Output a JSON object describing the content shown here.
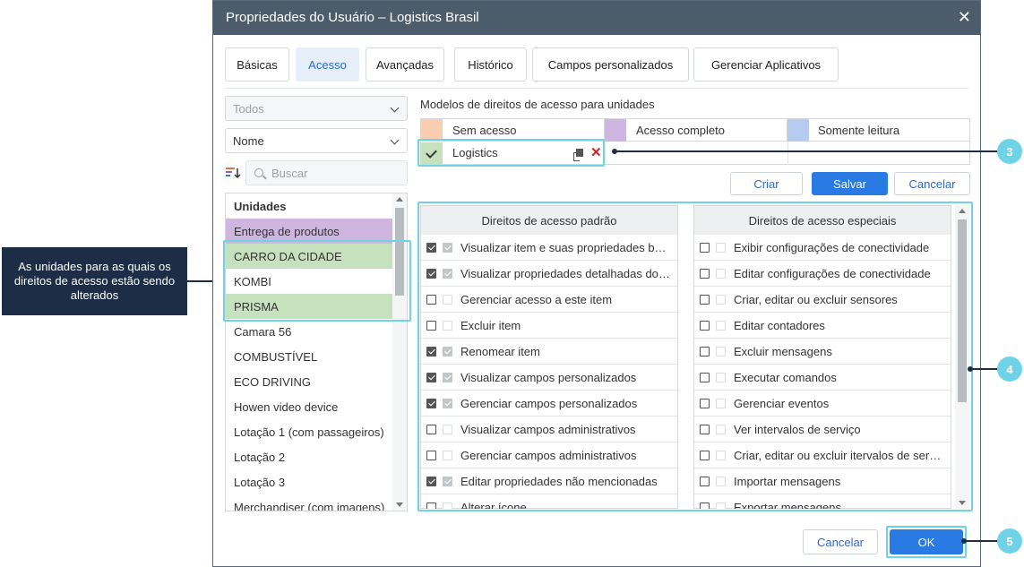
{
  "dialog": {
    "title": "Propriedades do Usuário – Logistics Brasil",
    "close_glyph": "✕"
  },
  "tabs": [
    {
      "label": "Básicas",
      "active": false
    },
    {
      "label": "Acesso",
      "active": true
    },
    {
      "label": "Avançadas",
      "active": false
    },
    {
      "label": "Histórico",
      "active": false
    },
    {
      "label": "Campos personalizados",
      "active": false
    },
    {
      "label": "Gerenciar Aplicativos",
      "active": false
    }
  ],
  "filters": {
    "type_select": "Todos",
    "sort_select": "Nome",
    "search_placeholder": "Buscar"
  },
  "units": {
    "header": "Unidades",
    "items": [
      {
        "label": "Entrega de produtos",
        "state": "purple"
      },
      {
        "label": "CARRO DA CIDADE",
        "state": "green"
      },
      {
        "label": "KOMBI",
        "state": "none"
      },
      {
        "label": "PRISMA",
        "state": "green"
      },
      {
        "label": "Camara 56",
        "state": "none"
      },
      {
        "label": "COMBUSTÍVEL",
        "state": "none"
      },
      {
        "label": "ECO DRIVING",
        "state": "none"
      },
      {
        "label": "Howen video device",
        "state": "none"
      },
      {
        "label": "Lotação 1 (com passageiros)",
        "state": "none"
      },
      {
        "label": "Lotação 2",
        "state": "none"
      },
      {
        "label": "Lotação 3",
        "state": "none"
      },
      {
        "label": "Merchandiser (com imagens)",
        "state": "none"
      }
    ]
  },
  "models": {
    "title": "Modelos de direitos de acesso para unidades",
    "legend": [
      {
        "label": "Sem acesso",
        "color": "#f8cdb0"
      },
      {
        "label": "Acesso completo",
        "color": "#cfb6e0"
      },
      {
        "label": "Somente leitura",
        "color": "#b5cbef"
      }
    ],
    "template": {
      "label": "Logistics",
      "color": "#c6e1bd"
    }
  },
  "actions": {
    "create": "Criar",
    "save": "Salvar",
    "cancel": "Cancelar"
  },
  "rights": {
    "standard_header": "Direitos de acesso padrão",
    "special_header": "Direitos de acesso especiais",
    "standard": [
      {
        "label": "Visualizar item e suas propriedades básicas",
        "checked": true
      },
      {
        "label": "Visualizar propriedades detalhadas do item",
        "checked": true
      },
      {
        "label": "Gerenciar acesso a este item",
        "checked": false
      },
      {
        "label": "Excluir item",
        "checked": false
      },
      {
        "label": "Renomear item",
        "checked": true
      },
      {
        "label": "Visualizar campos personalizados",
        "checked": true
      },
      {
        "label": "Gerenciar campos personalizados",
        "checked": true
      },
      {
        "label": "Visualizar campos administrativos",
        "checked": false
      },
      {
        "label": "Gerenciar campos administrativos",
        "checked": false
      },
      {
        "label": "Editar propriedades não mencionadas",
        "checked": true
      },
      {
        "label": "Alterar ícone",
        "checked": false
      }
    ],
    "special": [
      {
        "label": "Exibir configurações de conectividade",
        "checked": false
      },
      {
        "label": "Editar configurações de conectividade",
        "checked": false
      },
      {
        "label": "Criar, editar ou excluir sensores",
        "checked": false
      },
      {
        "label": "Editar contadores",
        "checked": false
      },
      {
        "label": "Excluir mensagens",
        "checked": false
      },
      {
        "label": "Executar comandos",
        "checked": false
      },
      {
        "label": "Gerenciar eventos",
        "checked": false
      },
      {
        "label": "Ver intervalos de serviço",
        "checked": false
      },
      {
        "label": "Criar, editar ou excluir itervalos de serviço",
        "checked": false
      },
      {
        "label": "Importar mensagens",
        "checked": false
      },
      {
        "label": "Exportar mensagens",
        "checked": false
      }
    ]
  },
  "footer": {
    "cancel": "Cancelar",
    "ok": "OK"
  },
  "annotations": {
    "note": "As unidades para as quais os direitos de acesso estão sendo alterados",
    "badges": [
      "3",
      "4",
      "5"
    ],
    "highlight_color": "#6fd3e8",
    "note_color": "#1d2d45"
  }
}
